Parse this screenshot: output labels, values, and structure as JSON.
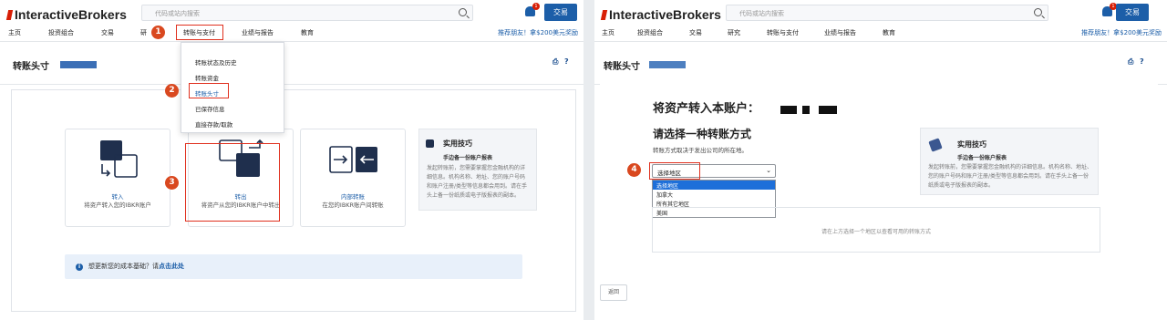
{
  "brand": "InteractiveBrokers",
  "search_placeholder": "代码或站内搜索",
  "notification_count": "1",
  "trade_label": "交易",
  "nav": [
    "主页",
    "投资组合",
    "交易",
    "研究",
    "转账与支付",
    "业绩与报告",
    "教育"
  ],
  "left_nav_research_fragment": "研",
  "promo": "推荐朋友！拿$200美元奖励",
  "page_title": "转账头寸",
  "menu_items": [
    "转账状态及历史",
    "转账资金",
    "转账头寸",
    "已保存信息",
    "直接存款/取款"
  ],
  "step_badges": [
    "1",
    "2",
    "3",
    "4"
  ],
  "cards": [
    {
      "title": "转入",
      "desc": "将资产转入您的IBKR账户"
    },
    {
      "title": "转出",
      "desc": "将资产从您的IBKR账户中转出"
    },
    {
      "title": "内部转账",
      "desc": "在您的IBKR账户间转账"
    }
  ],
  "tips": {
    "title": "实用技巧",
    "subtitle": "手边备一份账户报表",
    "body_left": "发起转账前，您需要掌握您金融机构的详细信息。机构名称、地址、您的账户号码和账户注册/类型等信息都会用到。请在手头上备一份纸质或电子版报表的副本。",
    "body_right": "发起转账前，您需要掌握您金融机构的详细信息。机构名称、地址、您的账户号码和账户注册/类型等信息都会用到。请在手头上备一份纸质或电子版报表的副本。"
  },
  "info_text": "想更新您的成本基础？请",
  "info_link": "点击此处",
  "right": {
    "heading": "将资产转入本账户：",
    "subheading": "请选择一种转账方式",
    "note": "转账方式取决于发出公司的所在地。",
    "select_value": "选择地区",
    "options": [
      "选择地区",
      "加拿大",
      "所有其它地区",
      "美国"
    ],
    "placeholder_box": "请在上方选择一个地区以查看可用的转账方式",
    "back_label": "返回"
  },
  "colors": {
    "accent": "#1c5ea8",
    "brand_red": "#d81e05",
    "highlight": "#e0301e",
    "badge": "#d9481f"
  }
}
